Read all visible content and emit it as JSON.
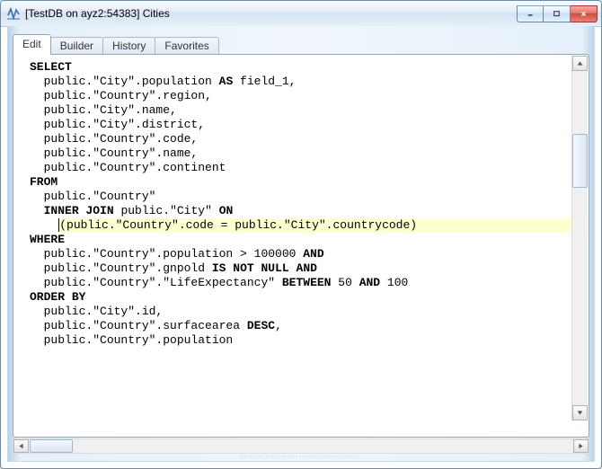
{
  "window": {
    "title": "[TestDB on ayz2:54383] Cities"
  },
  "tabs": [
    {
      "label": "Edit",
      "active": true
    },
    {
      "label": "Builder",
      "active": false
    },
    {
      "label": "History",
      "active": false
    },
    {
      "label": "Favorites",
      "active": false
    }
  ],
  "sql": {
    "lines": [
      {
        "kind": "kw",
        "text": "SELECT"
      },
      {
        "kind": "col",
        "text": "  public.\"City\".population AS field_1,"
      },
      {
        "kind": "col",
        "text": "  public.\"Country\".region,"
      },
      {
        "kind": "col",
        "text": "  public.\"City\".name,"
      },
      {
        "kind": "col",
        "text": "  public.\"City\".district,"
      },
      {
        "kind": "col",
        "text": "  public.\"Country\".code,"
      },
      {
        "kind": "col",
        "text": "  public.\"Country\".name,"
      },
      {
        "kind": "col",
        "text": "  public.\"Country\".continent"
      },
      {
        "kind": "kw",
        "text": "FROM"
      },
      {
        "kind": "plain",
        "text": "  public.\"Country\""
      },
      {
        "kind": "join",
        "text": "  INNER JOIN public.\"City\" ON"
      },
      {
        "kind": "hl",
        "text": "    (public.\"Country\".code = public.\"City\".countrycode)"
      },
      {
        "kind": "kw",
        "text": "WHERE"
      },
      {
        "kind": "cond",
        "text": "  public.\"Country\".population > 100000 AND"
      },
      {
        "kind": "cond",
        "text": "  public.\"Country\".gnpold IS NOT NULL AND"
      },
      {
        "kind": "cond",
        "text": "  public.\"Country\".\"LifeExpectancy\" BETWEEN 50 AND 100"
      },
      {
        "kind": "kw",
        "text": "ORDER BY"
      },
      {
        "kind": "ord",
        "text": "  public.\"City\".id,"
      },
      {
        "kind": "ord",
        "text": "  public.\"Country\".surfacearea DESC,"
      },
      {
        "kind": "ord",
        "text": "  public.\"Country\".population"
      }
    ]
  }
}
